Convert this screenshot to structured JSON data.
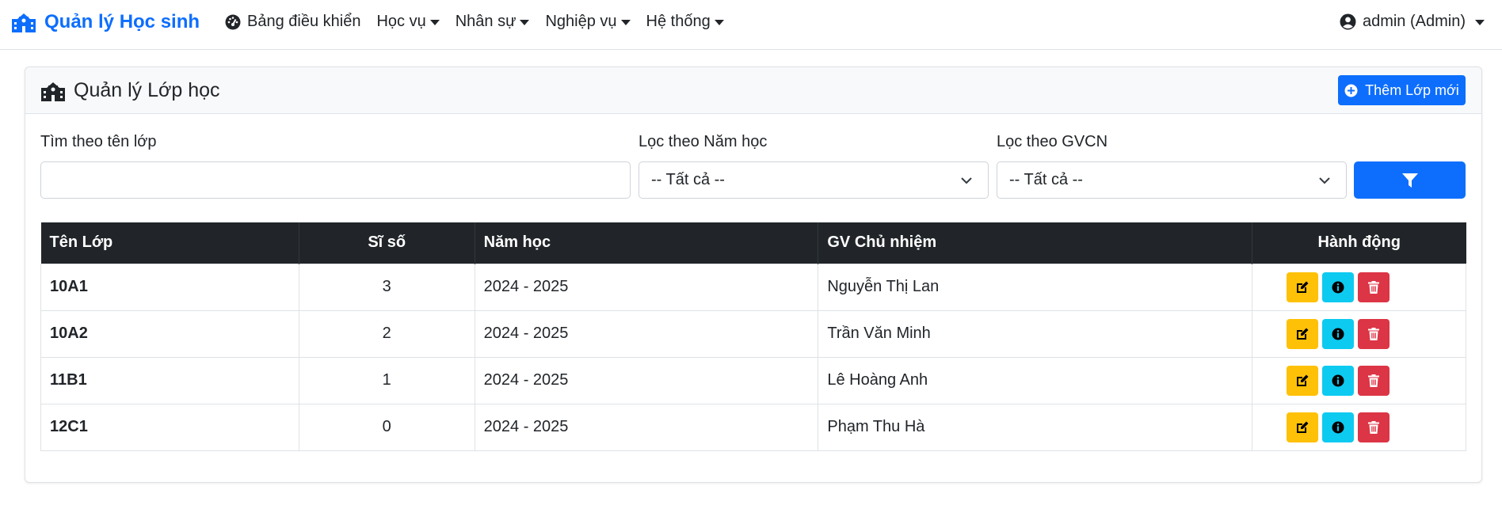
{
  "navbar": {
    "brand": "Quản lý Học sinh",
    "dashboard": "Bảng điều khiển",
    "menus": [
      "Học vụ",
      "Nhân sự",
      "Nghiệp vụ",
      "Hệ thống"
    ],
    "user": "admin (Admin)"
  },
  "card": {
    "title": "Quản lý Lớp học",
    "add_button": "Thêm Lớp mới"
  },
  "filters": {
    "search_label": "Tìm theo tên lớp",
    "search_value": "",
    "year_label": "Lọc theo Năm học",
    "year_selected": "-- Tất cả --",
    "teacher_label": "Lọc theo GVCN",
    "teacher_selected": "-- Tất cả --"
  },
  "table": {
    "headers": [
      "Tên Lớp",
      "Sĩ số",
      "Năm học",
      "GV Chủ nhiệm",
      "Hành động"
    ],
    "rows": [
      {
        "name": "10A1",
        "size": "3",
        "year": "2024 - 2025",
        "teacher": "Nguyễn Thị Lan"
      },
      {
        "name": "10A2",
        "size": "2",
        "year": "2024 - 2025",
        "teacher": "Trần Văn Minh"
      },
      {
        "name": "11B1",
        "size": "1",
        "year": "2024 - 2025",
        "teacher": "Lê Hoàng Anh"
      },
      {
        "name": "12C1",
        "size": "0",
        "year": "2024 - 2025",
        "teacher": "Phạm Thu Hà"
      }
    ]
  },
  "colors": {
    "primary": "#0d6efd",
    "warning": "#ffc107",
    "info": "#0dcaf0",
    "danger": "#dc3545",
    "dark": "#212529"
  },
  "icons": {
    "brand": "school-icon",
    "dashboard": "speedometer-icon",
    "user": "user-circle-icon",
    "add": "plus-circle-icon",
    "filter": "filter-icon",
    "edit": "edit-icon",
    "info": "info-icon",
    "delete": "trash-icon"
  }
}
